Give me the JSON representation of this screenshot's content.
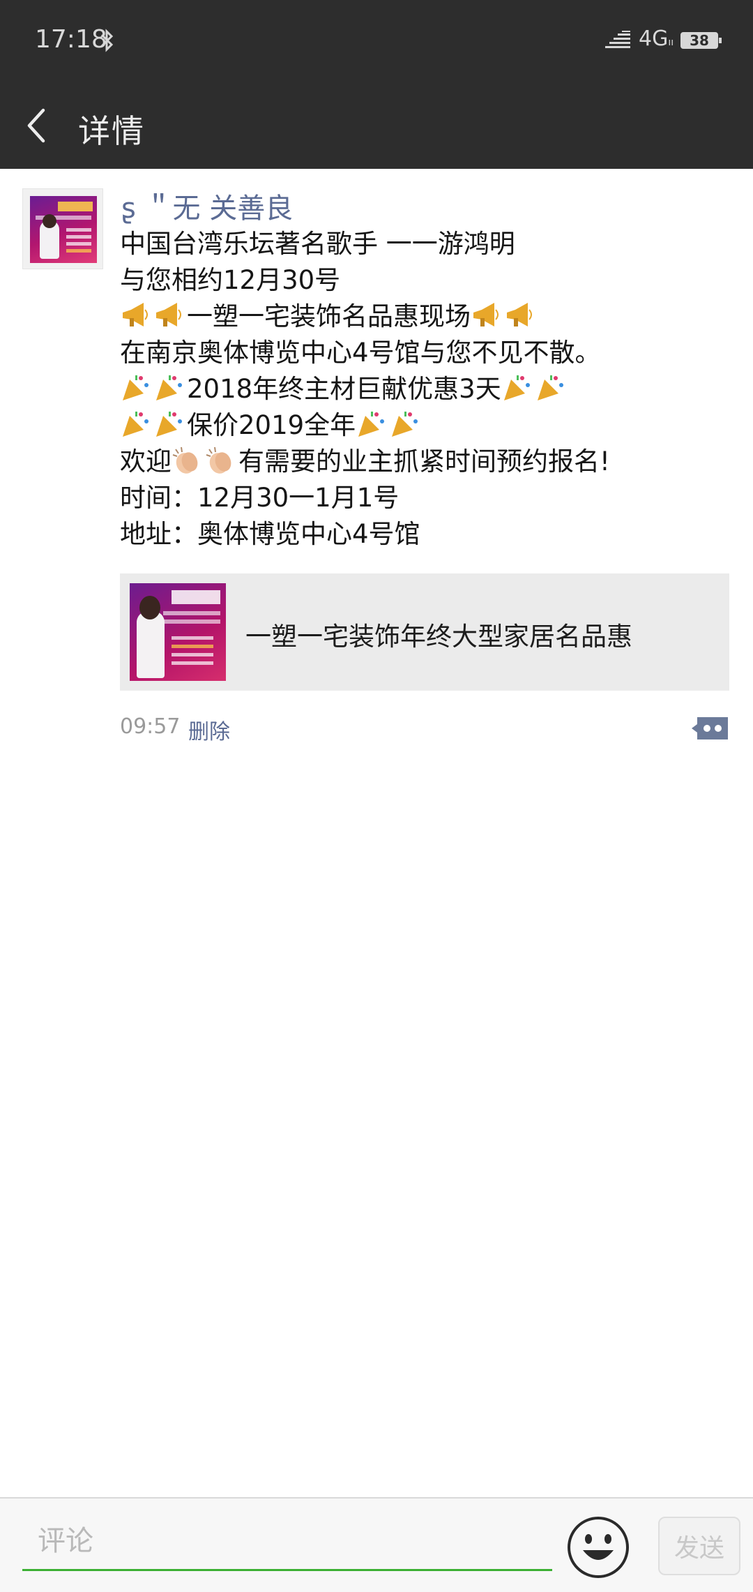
{
  "status_bar": {
    "time": "17:18",
    "network": "4G",
    "network_sub": "ıı",
    "battery": "38",
    "icons": [
      "bluetooth-icon",
      "signal-icon",
      "battery-icon"
    ]
  },
  "nav": {
    "title": "详情",
    "back_icon": "chevron-left-icon"
  },
  "post": {
    "author": "ʂ ＂无  关善良",
    "lines": [
      {
        "text": "中国台湾乐坛著名歌手 一一游鸿明"
      },
      {
        "text": "与您相约12月30号"
      },
      {
        "prefix": "一塑一宅装饰名品惠现场",
        "emoji": "megaphone-icon"
      },
      {
        "text": "在南京奥体博览中心4号馆与您不见不散。"
      },
      {
        "prefix": "2018年终主材巨献优惠3天",
        "emoji": "party-popper-icon"
      },
      {
        "prefix": "保价2019全年",
        "emoji": "party-popper-icon"
      },
      {
        "before": "欢迎",
        "after": "有需要的业主抓紧时间预约报名!",
        "emoji": "clapping-hands-icon"
      },
      {
        "text": "时间：12月30一1月1号"
      },
      {
        "text": "地址：奥体博览中心4号馆"
      }
    ],
    "link_card": {
      "title": "一塑一宅装饰年终大型家居名品惠"
    },
    "time": "09:57",
    "delete_label": "删除"
  },
  "comment_bar": {
    "placeholder": "评论",
    "send_label": "发送",
    "emoji_icon": "smiley-face-icon"
  },
  "colors": {
    "header_bg": "#2d2d2d",
    "link_blue": "#5b6b94",
    "input_green": "#3cb034",
    "card_bg": "#ebebeb"
  }
}
